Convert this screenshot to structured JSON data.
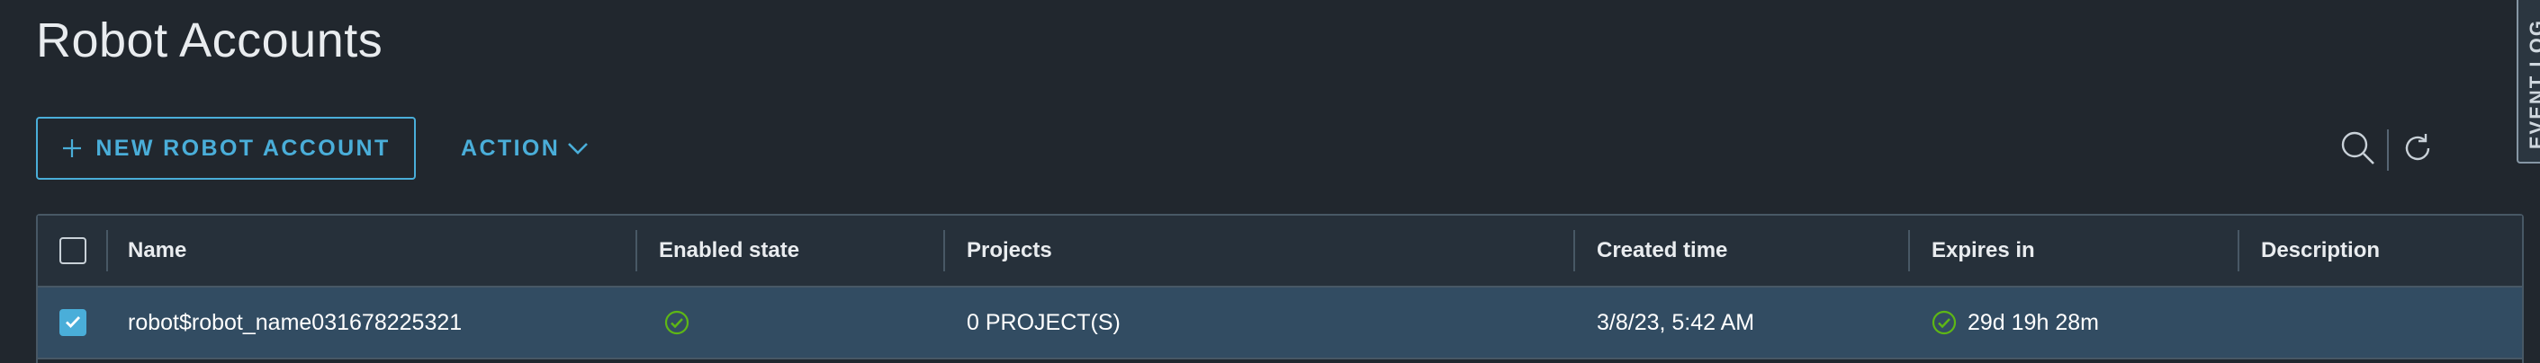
{
  "page": {
    "title": "Robot Accounts"
  },
  "toolbar": {
    "new_robot_label": "NEW ROBOT ACCOUNT",
    "action_label": "ACTION",
    "search_icon": "search-icon",
    "refresh_icon": "refresh-icon"
  },
  "side_panel": {
    "event_log_label": "EVENT LOG"
  },
  "table": {
    "columns": [
      "Name",
      "Enabled state",
      "Projects",
      "Created time",
      "Expires in",
      "Description"
    ],
    "rows": [
      {
        "selected": true,
        "name": "robot$robot_name031678225321",
        "enabled_state_icon": "check-circle-icon",
        "projects": "0 PROJECT(S)",
        "created_time": "3/8/23, 5:42 AM",
        "expires_in": "29d 19h 28m",
        "expires_icon": "check-circle-icon",
        "description": ""
      }
    ]
  },
  "colors": {
    "background": "#21272e",
    "accent": "#4aaed9",
    "selected_row": "#324c62",
    "success": "#5eb715"
  }
}
